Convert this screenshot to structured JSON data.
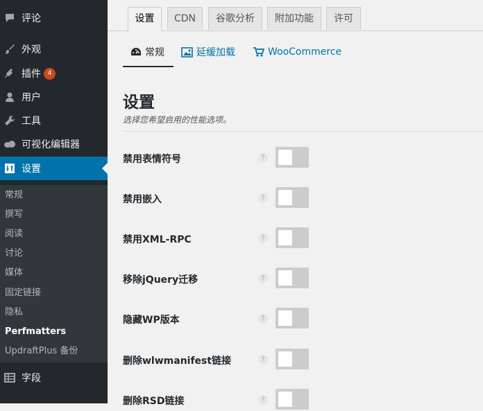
{
  "sidebar": {
    "menu": [
      {
        "label": "评论",
        "icon": "comment-icon"
      },
      {
        "label": "外观",
        "icon": "brush-icon"
      },
      {
        "label": "插件",
        "icon": "plugin-icon",
        "badge": "4"
      },
      {
        "label": "用户",
        "icon": "user-icon"
      },
      {
        "label": "工具",
        "icon": "wrench-icon"
      },
      {
        "label": "可视化编辑器",
        "icon": "cloud-icon"
      },
      {
        "label": "设置",
        "icon": "settings-icon",
        "active": true
      },
      {
        "label": "字段",
        "icon": "table-icon"
      }
    ],
    "submenu": [
      "常规",
      "撰写",
      "阅读",
      "讨论",
      "媒体",
      "固定链接",
      "隐私",
      "Perfmatters",
      "UpdraftPlus 备份"
    ]
  },
  "tabs": [
    "设置",
    "CDN",
    "谷歌分析",
    "附加功能",
    "许可"
  ],
  "subtabs": [
    {
      "label": "常规",
      "icon": "dashboard-icon"
    },
    {
      "label": "延缓加载",
      "icon": "image-icon"
    },
    {
      "label": "WooCommerce",
      "icon": "cart-icon"
    }
  ],
  "section": {
    "title": "设置",
    "description": "选择您希望启用的性能选项。"
  },
  "options": [
    {
      "label": "禁用表情符号",
      "enabled": false
    },
    {
      "label": "禁用嵌入",
      "enabled": false
    },
    {
      "label": "禁用XML-RPC",
      "enabled": false
    },
    {
      "label": "移除jQuery迁移",
      "enabled": false
    },
    {
      "label": "隐藏WP版本",
      "enabled": false
    },
    {
      "label": "删除wlwmanifest链接",
      "enabled": false
    },
    {
      "label": "删除RSD链接",
      "enabled": false
    }
  ],
  "help_glyph": "?",
  "colors": {
    "sidebar_bg": "#23282d",
    "submenu_bg": "#32373c",
    "active_blue": "#0073aa",
    "badge_orange": "#ca4a1f",
    "toggle_off": "#cccccc"
  }
}
